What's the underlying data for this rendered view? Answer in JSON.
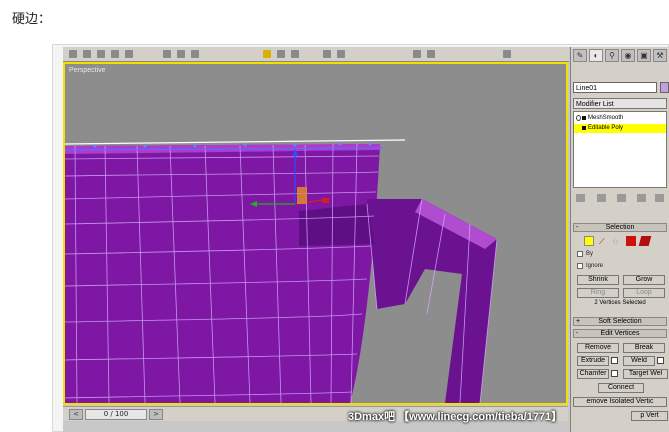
{
  "post": {
    "text": "硬边："
  },
  "app": {
    "viewport_label": "Perspective",
    "timeline": {
      "frame_counter": "0 / 100",
      "prev": "<",
      "next": ">"
    },
    "panel": {
      "object_name": "Line01",
      "modifier_list_label": "Modifier List",
      "stack": [
        "MeshSmooth",
        "Editable Poly"
      ],
      "selection": {
        "title": "Selection",
        "by_vertex_label": "By",
        "ignore_backfacing_label": "Ignore",
        "buttons": [
          "Shrink",
          "Grow",
          "Ring",
          "Loop"
        ],
        "status": "2 Vertices Selected"
      },
      "soft_selection": {
        "title": "Soft Selection"
      },
      "edit_vertices": {
        "title": "Edit Vertices",
        "buttons": [
          "Remove",
          "Break",
          "Extrude",
          "Weld",
          "Chamfer",
          "Target Wel",
          "Connect",
          "emove Isolated Vertic",
          "p Vert"
        ]
      }
    }
  },
  "watermark": "3Dmax吧 【www.linecg.com/tieba/1771】",
  "colors": {
    "mesh": "#8a1db0",
    "selected_mod": "#ffff00",
    "viewport_bg": "#8d8d8d",
    "active_border": "#f1e000"
  }
}
